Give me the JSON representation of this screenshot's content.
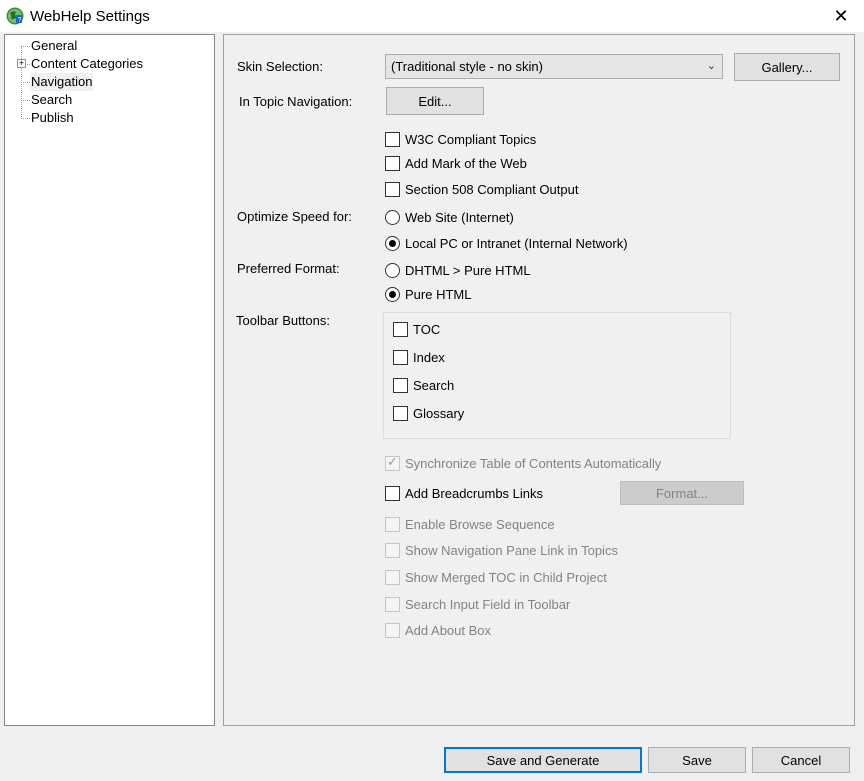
{
  "window": {
    "title": "WebHelp Settings",
    "icon": "webhelp-globe-icon",
    "close_glyph": "✕"
  },
  "tree": {
    "expander_glyph": "+",
    "items": [
      {
        "label": "General"
      },
      {
        "label": "Content Categories"
      },
      {
        "label": "Navigation",
        "selected": true
      },
      {
        "label": "Search"
      },
      {
        "label": "Publish"
      }
    ]
  },
  "skin": {
    "label": "Skin Selection:",
    "value": "(Traditional style - no skin)",
    "gallery_label": "Gallery..."
  },
  "topic_nav": {
    "label": "In Topic Navigation:",
    "edit_label": "Edit..."
  },
  "options": {
    "w3c": {
      "label": "W3C Compliant Topics",
      "checked": false
    },
    "motw": {
      "label": "Add Mark of the Web",
      "checked": false
    },
    "s508": {
      "label": "Section 508 Compliant Output",
      "checked": false
    }
  },
  "speed": {
    "label": "Optimize Speed for:",
    "web": "Web Site (Internet)",
    "local": "Local PC or Intranet (Internal Network)",
    "selected": "local"
  },
  "format": {
    "label": "Preferred Format:",
    "dhtml": "DHTML > Pure HTML",
    "pure": "Pure HTML",
    "selected": "pure"
  },
  "toolbar": {
    "label": "Toolbar Buttons:",
    "toc": "TOC",
    "index": "Index",
    "search": "Search",
    "glossary": "Glossary"
  },
  "sync": {
    "label": "Synchronize Table of Contents Automatically",
    "checked": true,
    "enabled": false
  },
  "breadcrumbs": {
    "label": "Add Breadcrumbs Links",
    "checked": false,
    "format_label": "Format..."
  },
  "disabled_options": {
    "browse": "Enable Browse Sequence",
    "navpane": "Show Navigation Pane Link in Topics",
    "merged": "Show Merged TOC in Child Project",
    "searchfield": "Search Input Field in Toolbar",
    "about": "Add About Box"
  },
  "footer": {
    "save_generate": "Save and Generate",
    "save": "Save",
    "cancel": "Cancel"
  },
  "colors": {
    "accent": "#0078d7",
    "disabled_text": "#838383"
  }
}
